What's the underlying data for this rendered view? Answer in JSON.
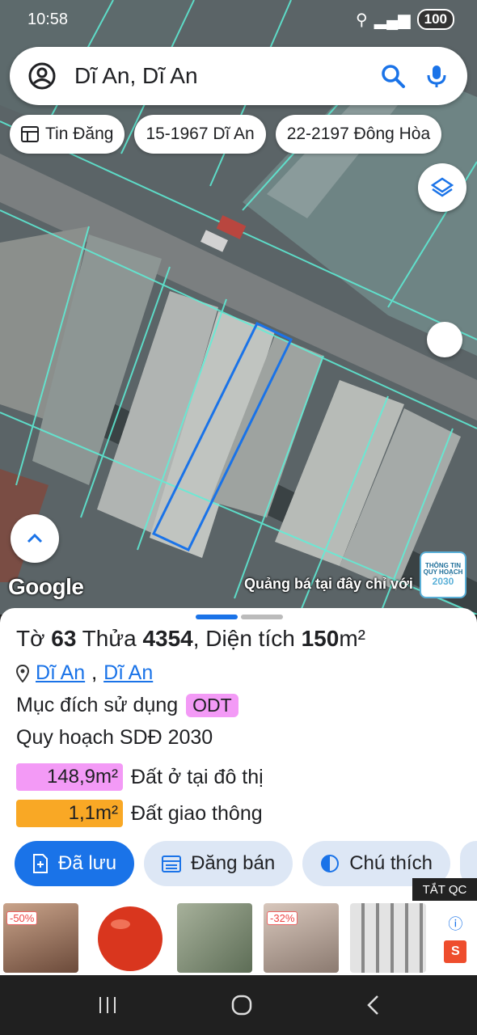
{
  "status": {
    "time": "10:58",
    "battery": "100"
  },
  "search": {
    "query": "Dĩ An, Dĩ An"
  },
  "chips": [
    {
      "label": "Tin Đăng",
      "icon": "list-icon"
    },
    {
      "label": "15-1967 Dĩ An"
    },
    {
      "label": "22-2197 Đông Hòa"
    }
  ],
  "map": {
    "attribution": "Google",
    "ad_text": "Quảng bá tại đây chỉ với",
    "ad_logo": "THÔNG TIN QUY HOẠCH",
    "ad_logo_num": "2030"
  },
  "parcel": {
    "t1": "Tờ ",
    "sheet_no": "63",
    "t2": " Thửa ",
    "plot_no": "4354",
    "t3": ", Diện tích ",
    "area": "150",
    "unit": "m²",
    "loc1": "Dĩ An",
    "sep": ",",
    "loc2": "Dĩ An",
    "purpose_label": "Mục đích sử dụng",
    "purpose_code": "ODT",
    "plan_label": "Quy hoạch SDĐ 2030",
    "zones": [
      {
        "area": "148,9m²",
        "label": "Đất ở tại đô thị",
        "color": "#f39af6"
      },
      {
        "area": "1,1m²",
        "label": "Đất giao thông",
        "color": "#f9a825"
      }
    ]
  },
  "actions": [
    {
      "label": "Đã lưu",
      "icon": "saved-icon"
    },
    {
      "label": "Đăng bán",
      "icon": "calendar-icon"
    },
    {
      "label": "Chú thích",
      "icon": "contrast-icon"
    }
  ],
  "ad_close": "TẮT QC",
  "ads": [
    {
      "discount": "-50%"
    },
    {
      "discount": ""
    },
    {
      "discount": ""
    },
    {
      "discount": "-32%"
    },
    {
      "discount": ""
    }
  ]
}
